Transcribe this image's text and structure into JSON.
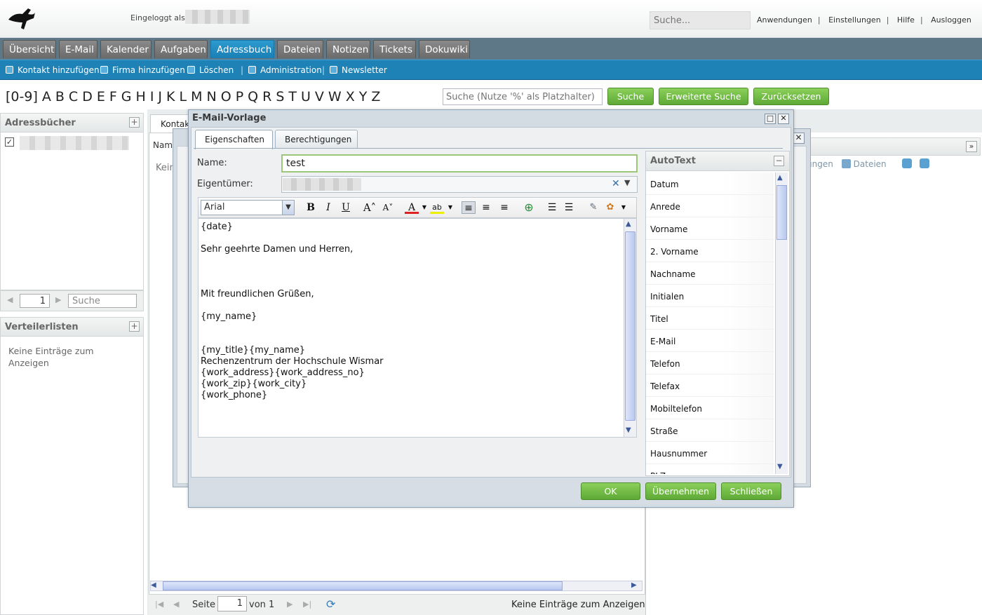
{
  "header": {
    "login_label": "Eingeloggt als",
    "search_placeholder": "Suche...",
    "links": [
      "Anwendungen",
      "Einstellungen",
      "Hilfe",
      "Ausloggen"
    ]
  },
  "modules": {
    "tabs": [
      "Übersicht",
      "E-Mail",
      "Kalender",
      "Aufgaben",
      "Adressbuch",
      "Dateien",
      "Notizen",
      "Tickets",
      "Dokuwiki"
    ],
    "active": "Adressbuch"
  },
  "actions": [
    "Kontakt hinzufügen",
    "Firma hinzufügen",
    "Löschen",
    "Administration",
    "Newsletter"
  ],
  "alphabet": [
    "[0-9]",
    "A",
    "B",
    "C",
    "D",
    "E",
    "F",
    "G",
    "H",
    "I",
    "J",
    "K",
    "L",
    "M",
    "N",
    "O",
    "P",
    "Q",
    "R",
    "S",
    "T",
    "U",
    "V",
    "W",
    "X",
    "Y",
    "Z"
  ],
  "search": {
    "placeholder": "Suche (Nutze '%' als Platzhalter)",
    "buttons": [
      "Suche",
      "Erweiterte Suche",
      "Zurücksetzen"
    ]
  },
  "left": {
    "addressbooks_title": "Adressbücher",
    "pager_page": "1",
    "pager_search": "Suche",
    "lists_title": "Verteilerlisten",
    "lists_empty": "Keine Einträge zum Anzeigen"
  },
  "main": {
    "tab_label": "Kontakte",
    "grid_header": "Name",
    "side_empty": "Kein",
    "bottom": {
      "page_label": "Seite",
      "page": "1",
      "of": "von 1",
      "empty": "Keine Einträge zum Anzeigen"
    },
    "right_toolbar": [
      "ungen",
      "Dateien"
    ]
  },
  "dialog": {
    "title": "E-Mail-Vorlage",
    "tabs": [
      "Eigenschaften",
      "Berechtigungen"
    ],
    "name_label": "Name:",
    "name_value": "test",
    "owner_label": "Eigentümer:",
    "font": "Arial",
    "body_lines": [
      "{date}",
      "",
      "Sehr geehrte Damen und Herren,",
      "",
      "",
      "",
      "Mit freundlichen Grüßen,",
      "",
      "{my_name}",
      "",
      "",
      "{my_title}{my_name}",
      "Rechenzentrum der Hochschule Wismar",
      "{work_address}{work_address_no}",
      "{work_zip}{work_city}",
      "{work_phone}"
    ],
    "autotext_title": "AutoText",
    "autotext_items": [
      "Datum",
      "Anrede",
      "Vorname",
      "2. Vorname",
      "Nachname",
      "Initialen",
      "Titel",
      "E-Mail",
      "Telefon",
      "Telefax",
      "Mobiltelefon",
      "Straße",
      "Hausnummer",
      "PLZ"
    ],
    "buttons": [
      "OK",
      "Übernehmen",
      "Schließen"
    ]
  },
  "colors": {
    "accent_blue": "#1e82b7",
    "button_green": "#5ea936",
    "module_bar": "#5f7888"
  }
}
